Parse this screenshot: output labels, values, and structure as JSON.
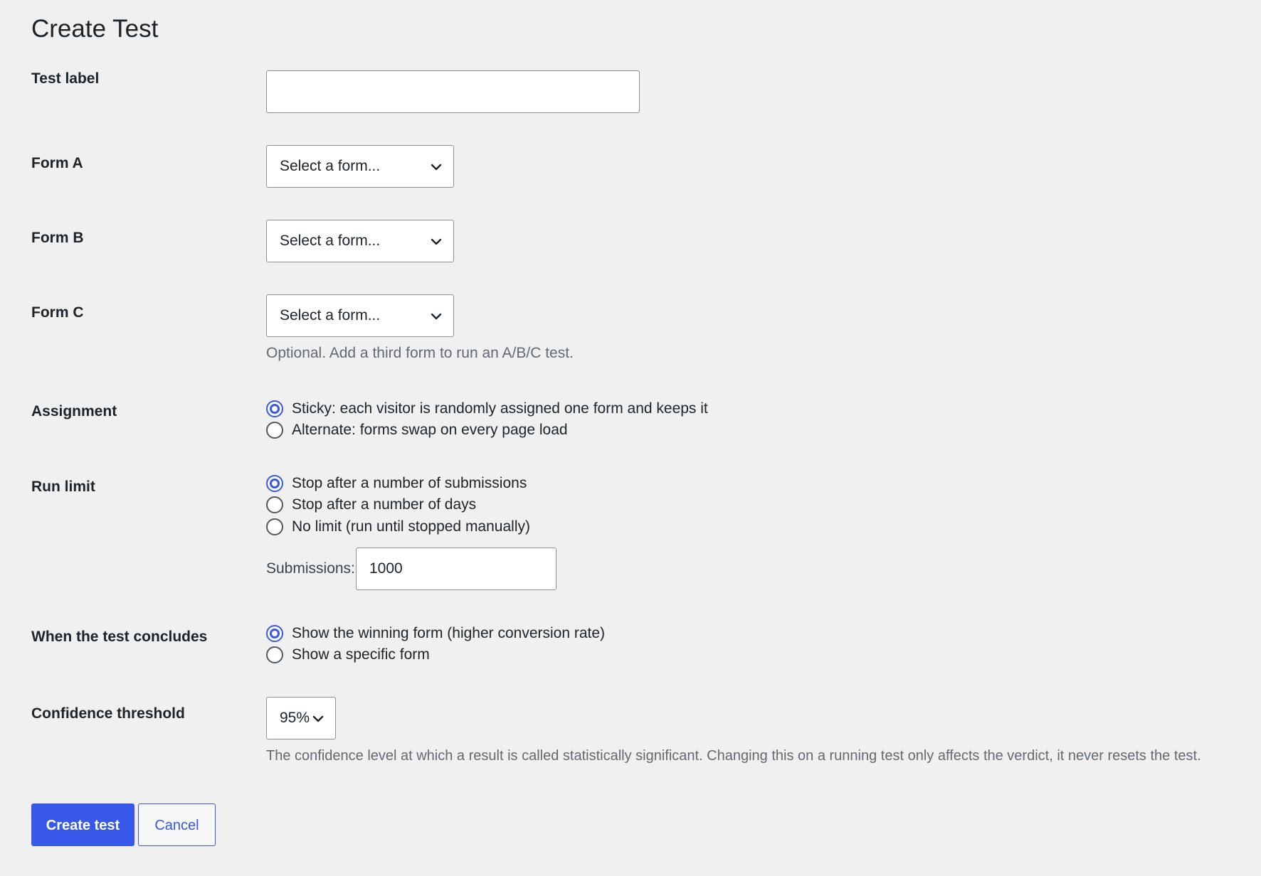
{
  "page": {
    "title": "Create Test"
  },
  "form": {
    "test_label": {
      "label": "Test label",
      "value": ""
    },
    "form_a": {
      "label": "Form A",
      "selected": "Select a form..."
    },
    "form_b": {
      "label": "Form B",
      "selected": "Select a form..."
    },
    "form_c": {
      "label": "Form C",
      "selected": "Select a form...",
      "help": "Optional. Add a third form to run an A/B/C test."
    },
    "assignment": {
      "label": "Assignment",
      "options": [
        {
          "label": "Sticky: each visitor is randomly assigned one form and keeps it",
          "checked": true
        },
        {
          "label": "Alternate: forms swap on every page load",
          "checked": false
        }
      ]
    },
    "run_limit": {
      "label": "Run limit",
      "options": [
        {
          "label": "Stop after a number of submissions",
          "checked": true
        },
        {
          "label": "Stop after a number of days",
          "checked": false
        },
        {
          "label": "No limit (run until stopped manually)",
          "checked": false
        }
      ],
      "submissions_label": "Submissions:",
      "submissions_value": "1000"
    },
    "conclusion": {
      "label": "When the test concludes",
      "options": [
        {
          "label": "Show the winning form (higher conversion rate)",
          "checked": true
        },
        {
          "label": "Show a specific form",
          "checked": false
        }
      ]
    },
    "confidence": {
      "label": "Confidence threshold",
      "selected": "95%",
      "help": "The confidence level at which a result is called statistically significant. Changing this on a running test only affects the verdict, it never resets the test."
    }
  },
  "actions": {
    "create_label": "Create test",
    "cancel_label": "Cancel"
  },
  "colors": {
    "accent": "#3858e9",
    "background": "#f0f0f1",
    "help_text": "#646970"
  },
  "icons": {
    "select_chevron": "chevron-down-icon"
  }
}
